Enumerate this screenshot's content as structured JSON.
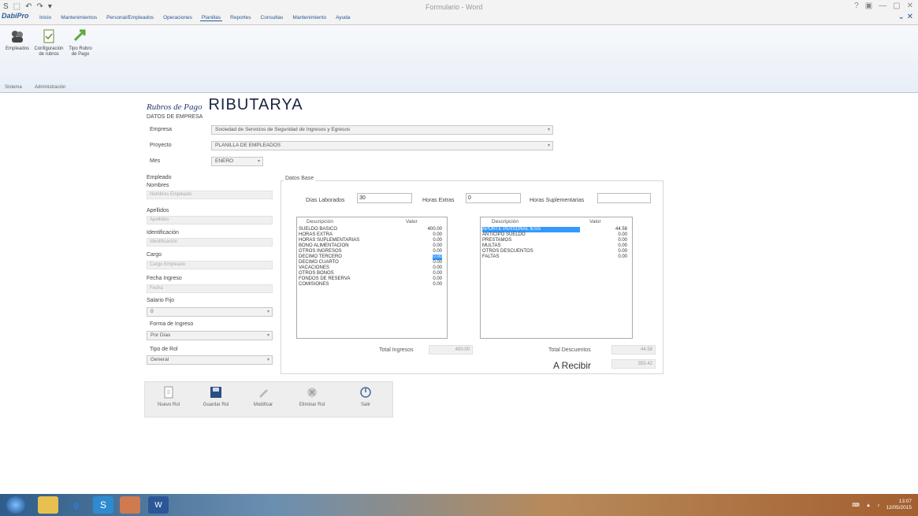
{
  "window": {
    "title": "Formulario - Word",
    "qat": [
      "S",
      "⬚",
      "↶",
      "↷",
      "▾"
    ],
    "controls": [
      "?",
      "▣",
      "—",
      "▢",
      "✕"
    ]
  },
  "ribbon": {
    "logo": "DabiPro",
    "tabs": [
      "Inicio",
      "Mantenimientos",
      "Personal/Empleados",
      "Operaciones",
      "Planillas",
      "Reportes",
      "Consultas",
      "Mantenimiento",
      "Ayuda"
    ],
    "active_tab": 4,
    "buttons": [
      {
        "label": "Empleados",
        "icon": "employees-icon"
      },
      {
        "label": "Configuración de rubros",
        "icon": "document-icon"
      },
      {
        "label": "Tipo Rubro de Pago",
        "icon": "arrow-icon"
      }
    ],
    "groups": [
      "Sistema",
      "Administración"
    ]
  },
  "page": {
    "small_title": "Rubros de Pago",
    "big_title": "RIBUTARYA"
  },
  "company": {
    "section_label": "DATOS DE EMPRESA",
    "empresa_label": "Empresa",
    "empresa_value": "Sociedad de Servicios de Seguridad de Ingresos y Egresos",
    "proyecto_label": "Proyecto",
    "proyecto_value": "PLANILLA DE EMPLEADOS",
    "mes_label": "Mes",
    "mes_value": "ENERO"
  },
  "employee": {
    "section_label": "Empleado",
    "fields": [
      {
        "label": "Nombres",
        "value": "Nombres Empleado"
      },
      {
        "label": "Apellidos",
        "value": "Apellidos"
      },
      {
        "label": "Identificación",
        "value": "Identificación"
      },
      {
        "label": "Cargo",
        "value": "Cargo Empleado"
      },
      {
        "label": "Fecha Ingreso",
        "value": "Fecha"
      }
    ],
    "salario_label": "Salario Fijo",
    "salario_value": "0",
    "forma_label": "Forma de Ingreso",
    "forma_value": "Por Días",
    "tipo_label": "Tipo de Rol",
    "tipo_value": "General"
  },
  "datos": {
    "section_label": "Datos Base",
    "dias_label": "Días Laborados",
    "dias_value": "30",
    "horas_label": "Horas Extras",
    "horas_value": "0",
    "horas_sup_label": "Horas Suplementarias",
    "horas_sup_value": ""
  },
  "ingresos": {
    "col_desc": "Descripción",
    "col_val": "Valor",
    "rows": [
      {
        "desc": "SUELDO BASICO",
        "val": "400.00"
      },
      {
        "desc": "HORAS EXTRA",
        "val": "0.00"
      },
      {
        "desc": "HORAS SUPLEMENTARIAS",
        "val": "0.00"
      },
      {
        "desc": "BONO ALIMENTACION",
        "val": "0.00"
      },
      {
        "desc": "OTROS INGRESOS",
        "val": "0.00"
      },
      {
        "desc": "DECIMO TERCERO",
        "val": "0.00"
      },
      {
        "desc": "DECIMO CUARTO",
        "val": "0.00"
      },
      {
        "desc": "VACACIONES",
        "val": "0.00"
      },
      {
        "desc": "OTROS BONOS",
        "val": "0.00"
      },
      {
        "desc": "FONDOS DE RESERVA",
        "val": "0.00"
      },
      {
        "desc": "COMISIONES",
        "val": "0.00"
      }
    ],
    "total_label": "Total Ingresos",
    "total_value": "400.00"
  },
  "descuentos": {
    "col_desc": "Descripción",
    "col_val": "Valor",
    "rows": [
      {
        "desc": "APORTE PERSONAL IESS",
        "val": "44.58"
      },
      {
        "desc": "ANTICIPO SUELDO",
        "val": "0.00"
      },
      {
        "desc": "PRESTAMOS",
        "val": "0.00"
      },
      {
        "desc": "MULTAS",
        "val": "0.00"
      },
      {
        "desc": "OTROS DESCUENTOS",
        "val": "0.00"
      },
      {
        "desc": "FALTAS",
        "val": "0.00"
      }
    ],
    "total_label": "Total Descuentos",
    "total_value": "44.58",
    "arecibir_label": "A Recibir",
    "arecibir_value": "355.42"
  },
  "actions": [
    {
      "label": "Nuevo Rol",
      "icon": "new-icon"
    },
    {
      "label": "Guardar Rol",
      "icon": "save-icon"
    },
    {
      "label": "Modificar",
      "icon": "edit-icon"
    },
    {
      "label": "Eliminar Rol",
      "icon": "delete-icon"
    },
    {
      "label": "Salir",
      "icon": "exit-icon"
    }
  ],
  "taskbar": {
    "items": [
      "start-orb",
      "explorer",
      "ie",
      "app",
      "user",
      "word"
    ],
    "time": "13:07",
    "date": "12/05/2015"
  }
}
